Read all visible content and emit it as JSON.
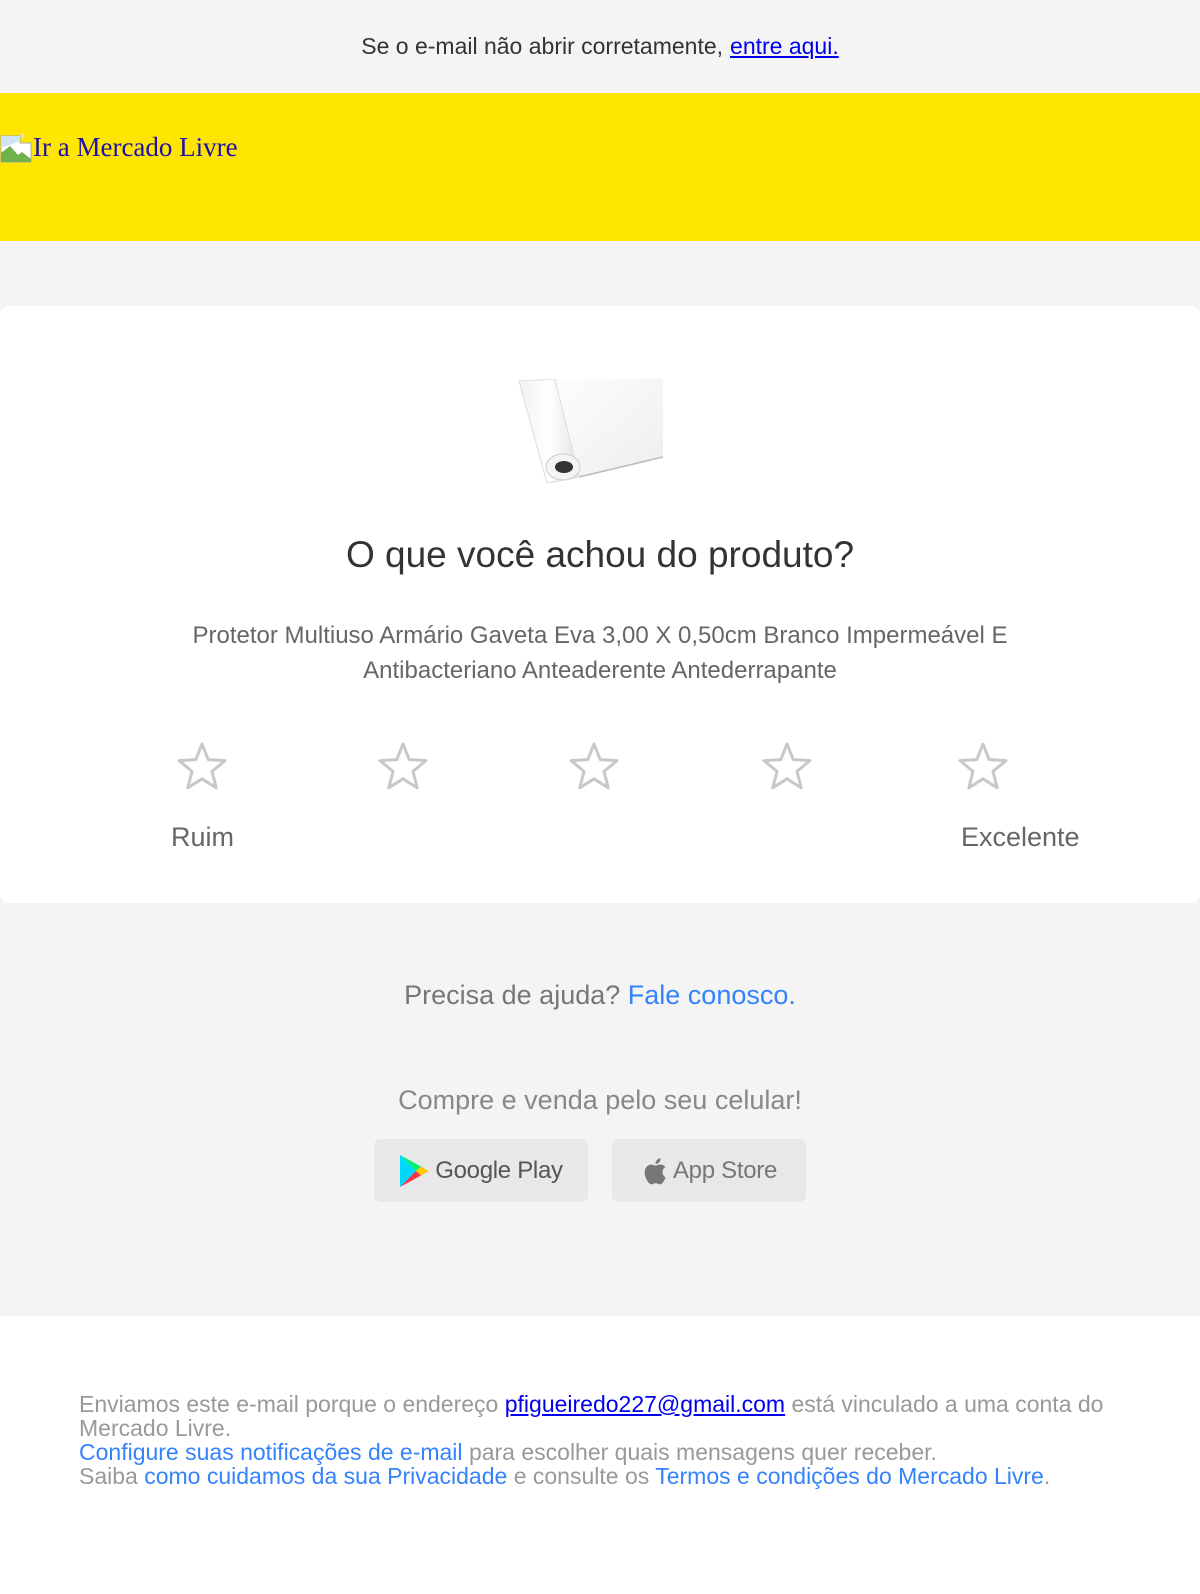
{
  "topbar": {
    "text": "Se o e-mail não abrir corretamente,",
    "link": "entre aqui."
  },
  "header": {
    "logo_alt": "Ir a Mercado Livre",
    "brand_color": "#ffe600"
  },
  "card": {
    "question": "O que você achou do produto?",
    "product_name": "Protetor Multiuso Armário Gaveta Eva 3,00 X 0,50cm Branco Impermeável E Antibacteriano Anteaderente Antederrapante",
    "rating": {
      "max_stars": 5,
      "selected": 0,
      "low_label": "Ruim",
      "high_label": "Excelente"
    }
  },
  "help": {
    "text": "Precisa de ajuda?",
    "link": "Fale conosco."
  },
  "apps": {
    "title": "Compre e venda pelo seu celular!",
    "google_play": "Google Play",
    "app_store": "App Store"
  },
  "footer": {
    "line1_pre": "Enviamos este e-mail porque o endereço",
    "email": "pfigueiredo227@gmail.com",
    "line1_post": "está vinculado a uma conta do Mercado Livre.",
    "line2_link": "Configure suas notificações de e-mail",
    "line2_post": "para escolher quais mensagens quer receber.",
    "line3_pre": "Saiba",
    "line3_link1": "como cuidamos da sua Privacidade",
    "line3_mid": "e consulte os",
    "line3_link2": "Termos e condições do Mercado Livre",
    "line3_end": "."
  },
  "colors": {
    "link_blue": "#3483fa",
    "text_gray": "#666666",
    "background": "#f4f4f4"
  }
}
